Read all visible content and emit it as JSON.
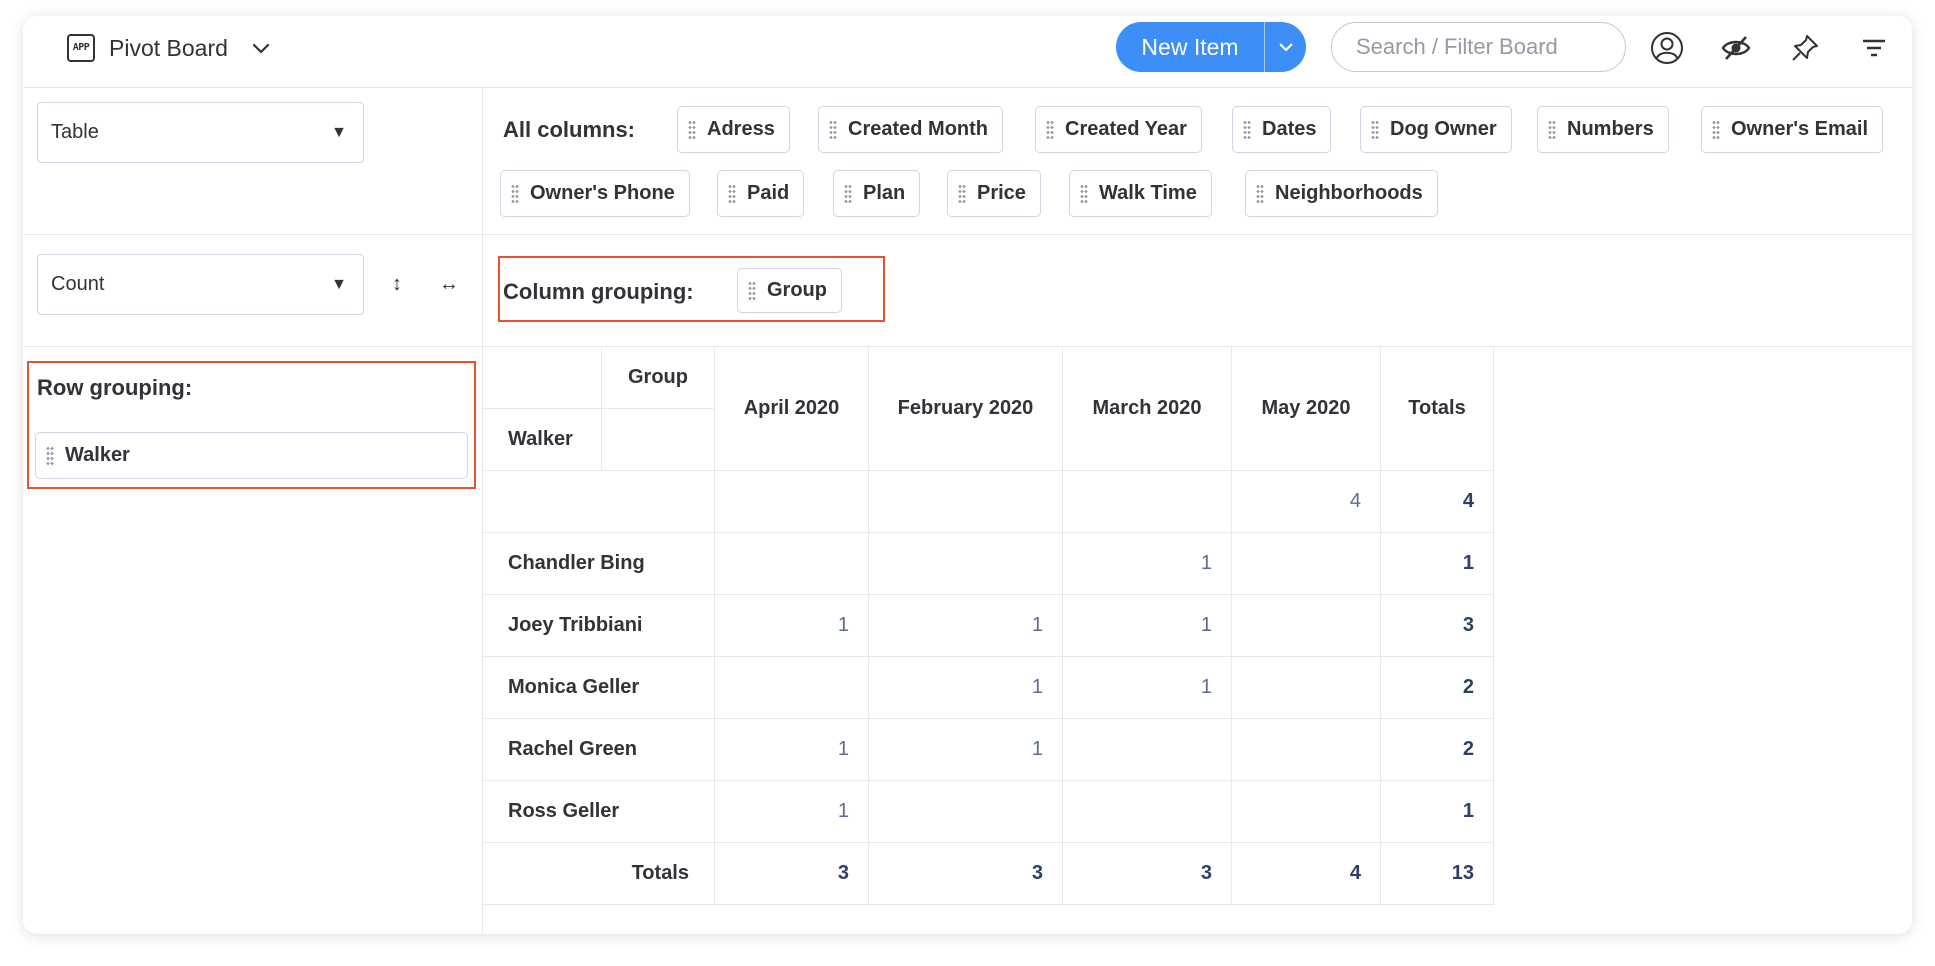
{
  "header": {
    "app_icon_text": "APP",
    "title": "Pivot Board",
    "new_item_label": "New Item",
    "search_placeholder": "Search / Filter Board",
    "accent_color": "#3d8ff7",
    "icons": [
      "chevron-down-icon",
      "person-icon",
      "eye-off-icon",
      "pin-icon",
      "filter-icon"
    ]
  },
  "controls": {
    "view_select": "Table",
    "aggregation_select": "Count",
    "select_arrow": "▼",
    "swap_vertical_glyph": "↕",
    "swap_horizontal_glyph": "↔"
  },
  "all_columns": {
    "label": "All columns:",
    "chips": [
      "Adress",
      "Created Month",
      "Created Year",
      "Dates",
      "Dog Owner",
      "Numbers",
      "Owner's Email",
      "Owner's Phone",
      "Paid",
      "Plan",
      "Price",
      "Walk Time",
      "Neighborhoods"
    ]
  },
  "column_grouping": {
    "label": "Column grouping:",
    "chips": [
      "Group"
    ]
  },
  "row_grouping": {
    "label": "Row grouping:",
    "chips": [
      "Walker"
    ]
  },
  "highlight_color": "#e8532f",
  "pivot": {
    "column_field": "Group",
    "row_field": "Walker",
    "columns": [
      "April 2020",
      "February 2020",
      "March 2020",
      "May 2020"
    ],
    "totals_label": "Totals",
    "rows": [
      {
        "label": "",
        "cells": [
          "",
          "",
          "",
          "4"
        ],
        "total": "4"
      },
      {
        "label": "Chandler Bing",
        "cells": [
          "",
          "",
          "1",
          ""
        ],
        "total": "1"
      },
      {
        "label": "Joey Tribbiani",
        "cells": [
          "1",
          "1",
          "1",
          ""
        ],
        "total": "3"
      },
      {
        "label": "Monica Geller",
        "cells": [
          "",
          "1",
          "1",
          ""
        ],
        "total": "2"
      },
      {
        "label": "Rachel Green",
        "cells": [
          "1",
          "1",
          "",
          ""
        ],
        "total": "2"
      },
      {
        "label": "Ross Geller",
        "cells": [
          "1",
          "",
          "",
          ""
        ],
        "total": "1"
      }
    ],
    "column_totals": [
      "3",
      "3",
      "3",
      "4"
    ],
    "grand_total": "13"
  }
}
